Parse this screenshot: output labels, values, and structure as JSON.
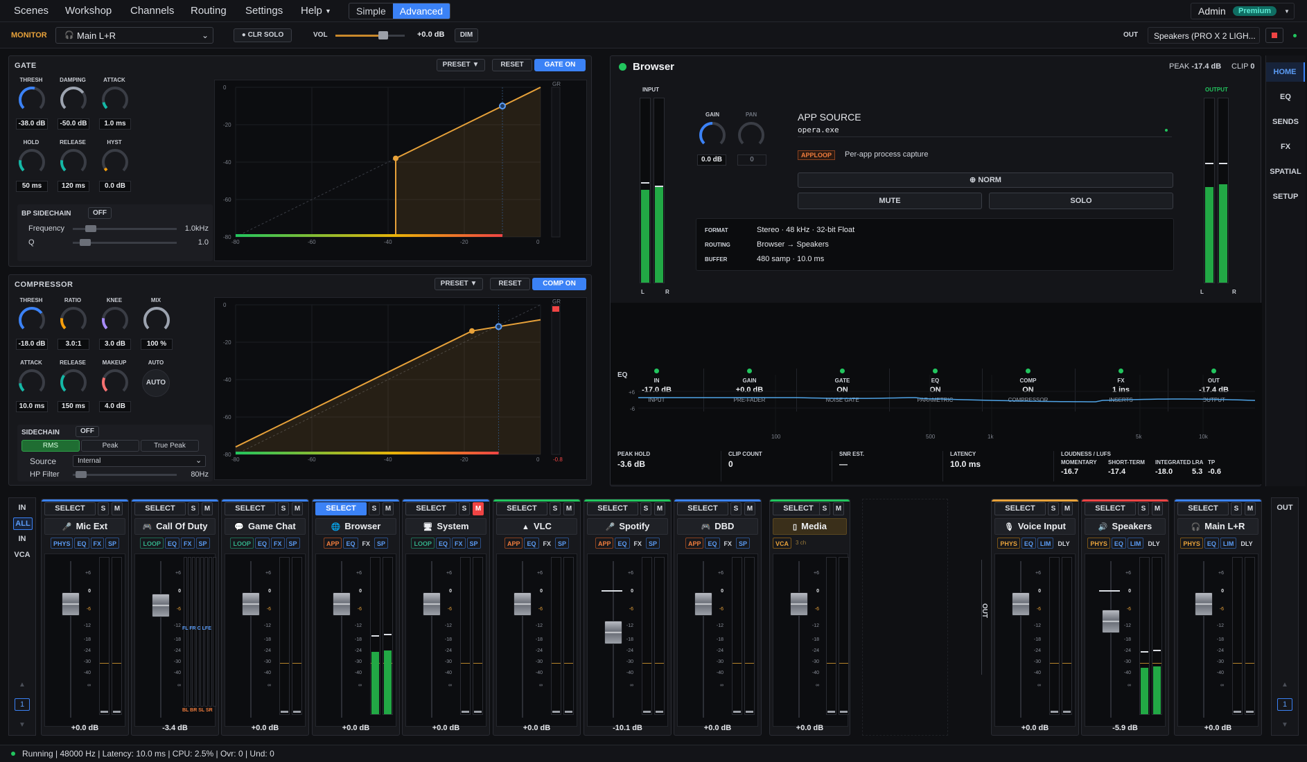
{
  "menu": {
    "items": [
      "Scenes",
      "Workshop",
      "Channels",
      "Routing",
      "Settings",
      "Help"
    ],
    "mode_simple": "Simple",
    "mode_advanced": "Advanced",
    "user": "Admin",
    "badge": "Premium"
  },
  "monitor": {
    "label": "MONITOR",
    "device": "Main L+R",
    "clr_solo": "● CLR SOLO",
    "vol_label": "VOL",
    "vol_value": "+0.0 dB",
    "dim": "DIM",
    "out_label": "OUT",
    "out_device": "Speakers (PRO X 2 LIGH..."
  },
  "gate": {
    "title": "GATE",
    "preset": "PRESET ▼",
    "reset": "RESET",
    "toggle": "GATE ON",
    "knobs": [
      {
        "label": "THRESH",
        "value": "-38.0 dB"
      },
      {
        "label": "DAMPING",
        "value": "-50.0 dB"
      },
      {
        "label": "ATTACK",
        "value": "1.0 ms"
      },
      {
        "label": "HOLD",
        "value": "50 ms"
      },
      {
        "label": "RELEASE",
        "value": "120 ms"
      },
      {
        "label": "HYST",
        "value": "0.0 dB"
      }
    ],
    "sidechain_label": "BP SIDECHAIN",
    "sidechain_state": "OFF",
    "freq_label": "Frequency",
    "freq_value": "1.0kHz",
    "q_label": "Q",
    "q_value": "1.0",
    "y_ticks": [
      "0",
      "-20",
      "-40",
      "-60",
      "-80"
    ],
    "x_ticks": [
      "-80",
      "-60",
      "-40",
      "-20",
      "0"
    ],
    "gr": "GR"
  },
  "comp": {
    "title": "COMPRESSOR",
    "preset": "PRESET ▼",
    "reset": "RESET",
    "toggle": "COMP ON",
    "knobs": [
      {
        "label": "THRESH",
        "value": "-18.0 dB"
      },
      {
        "label": "RATIO",
        "value": "3.0:1"
      },
      {
        "label": "KNEE",
        "value": "3.0 dB"
      },
      {
        "label": "MIX",
        "value": "100 %"
      },
      {
        "label": "ATTACK",
        "value": "10.0 ms"
      },
      {
        "label": "RELEASE",
        "value": "150 ms"
      },
      {
        "label": "MAKEUP",
        "value": "4.0 dB"
      },
      {
        "label": "AUTO",
        "value": "AUTO"
      }
    ],
    "sidechain_label": "SIDECHAIN",
    "sidechain_state": "OFF",
    "modes": [
      "RMS",
      "Peak",
      "True Peak"
    ],
    "source_label": "Source",
    "source_value": "Internal",
    "hp_label": "HP Filter",
    "hp_value": "80Hz",
    "y_ticks": [
      "0",
      "-20",
      "-40",
      "-60",
      "-80"
    ],
    "x_ticks": [
      "-80",
      "-60",
      "-40",
      "-20",
      "0"
    ],
    "gr": "GR",
    "gr_value": "-0.8"
  },
  "channel": {
    "name": "Browser",
    "peak_label": "PEAK",
    "peak_value": "-17.4 dB",
    "clip_label": "CLIP",
    "clip_value": "0",
    "input_label": "INPUT",
    "output_label": "OUTPUT",
    "l": "L",
    "r": "R",
    "gain_label": "GAIN",
    "gain_value": "0.0 dB",
    "pan_label": "PAN",
    "pan_value": "0",
    "source_title": "APP SOURCE",
    "process": "opera.exe",
    "apploop": "APPLOOP",
    "apploop_desc": "Per-app process capture",
    "norm": "⊕ NORM",
    "mute": "MUTE",
    "solo": "SOLO",
    "info": [
      {
        "k": "FORMAT",
        "v": "Stereo · 48 kHz · 32-bit Float"
      },
      {
        "k": "ROUTING",
        "v": "Browser → Speakers"
      },
      {
        "k": "BUFFER",
        "v": "480 samp · 10.0 ms"
      }
    ],
    "stages": [
      {
        "t": "IN",
        "v": "-17.0 dB",
        "s": "INPUT"
      },
      {
        "t": "GAIN",
        "v": "+0.0 dB",
        "s": "PRE-FADER"
      },
      {
        "t": "GATE",
        "v": "ON",
        "s": "NOISE GATE"
      },
      {
        "t": "EQ",
        "v": "ON",
        "s": "PARAMETRIC"
      },
      {
        "t": "COMP",
        "v": "ON",
        "s": "COMPRESSOR"
      },
      {
        "t": "FX",
        "v": "1 ins",
        "s": "INSERTS"
      },
      {
        "t": "OUT",
        "v": "-17.4 dB",
        "s": "OUTPUT"
      }
    ],
    "eq_label": "EQ",
    "eq_y": [
      "+6",
      "-6"
    ],
    "eq_x": [
      "100",
      "500",
      "1k",
      "5k",
      "10k"
    ],
    "stats": [
      {
        "k": "PEAK HOLD",
        "v": "-3.6 dB"
      },
      {
        "k": "CLIP COUNT",
        "v": "0"
      },
      {
        "k": "SNR EST.",
        "v": "—"
      },
      {
        "k": "LATENCY",
        "v": "10.0 ms"
      }
    ],
    "loud_label": "LOUDNESS / LUFS",
    "loud": [
      {
        "k": "MOMENTARY",
        "v": "-16.7"
      },
      {
        "k": "SHORT-TERM",
        "v": "-17.4"
      },
      {
        "k": "INTEGRATED",
        "v": "-18.0"
      },
      {
        "k": "LRA",
        "v": "5.3"
      },
      {
        "k": "TP",
        "v": "-0.6"
      }
    ]
  },
  "sidenav": [
    "HOME",
    "EQ",
    "SENDS",
    "FX",
    "SPATIAL",
    "SETUP"
  ],
  "mixer": {
    "left": [
      "IN",
      "ALL",
      "IN",
      "VCA"
    ],
    "page": "1",
    "out_label": "OUT",
    "out_vertical": "OUT",
    "scale": [
      "+6",
      "0",
      "-6",
      "-12",
      "-18",
      "-24",
      "-30",
      "-40",
      "∞"
    ],
    "select": "SELECT",
    "s": "S",
    "m": "M",
    "strips": [
      {
        "name": "Mic Ext",
        "icon": "mic-icon",
        "glyph": "🎤",
        "tags": [
          "PHYS",
          "EQ",
          "FX",
          "SP"
        ],
        "value": "+0.0 dB",
        "color": "#3b82f6"
      },
      {
        "name": "Call Of Duty",
        "icon": "gamepad-icon",
        "glyph": "🎮",
        "tags": [
          "LOOP",
          "EQ",
          "FX",
          "SP"
        ],
        "value": "-3.4 dB",
        "color": "#3b82f6",
        "surround_top": "FL FR C LFE",
        "surround_bot": "BL BR SL SR"
      },
      {
        "name": "Game Chat",
        "icon": "chat-icon",
        "glyph": "💬",
        "tags": [
          "LOOP",
          "EQ",
          "FX",
          "SP"
        ],
        "value": "+0.0 dB",
        "color": "#3b82f6"
      },
      {
        "name": "Browser",
        "icon": "globe-icon",
        "glyph": "🌐",
        "tags": [
          "APP",
          "EQ",
          "FX",
          "SP"
        ],
        "value": "+0.0 dB",
        "color": "#3b82f6"
      },
      {
        "name": "System",
        "icon": "monitor-icon",
        "glyph": "🖥",
        "tags": [
          "LOOP",
          "EQ",
          "FX",
          "SP"
        ],
        "value": "+0.0 dB",
        "color": "#3b82f6"
      },
      {
        "name": "VLC",
        "icon": "cone-icon",
        "glyph": "▲",
        "tags": [
          "APP",
          "EQ",
          "FX",
          "SP"
        ],
        "value": "+0.0 dB",
        "color": "#22c55e"
      },
      {
        "name": "Spotify",
        "icon": "mic-icon",
        "glyph": "🎤",
        "tags": [
          "APP",
          "EQ",
          "FX",
          "SP"
        ],
        "value": "-10.1 dB",
        "color": "#22c55e"
      },
      {
        "name": "DBD",
        "icon": "gamepad-icon",
        "glyph": "🎮",
        "tags": [
          "APP",
          "EQ",
          "FX",
          "SP"
        ],
        "value": "+0.0 dB",
        "color": "#3b82f6"
      },
      {
        "name": "Media",
        "icon": "file-icon",
        "glyph": "▯",
        "tags": [
          "VCA"
        ],
        "vca_note": "3 ch",
        "value": "+0.0 dB",
        "color": "#22c55e"
      },
      {
        "name": "Voice Input",
        "icon": "mic-icon",
        "glyph": "🎙",
        "tags": [
          "PHYS",
          "EQ",
          "LIM",
          "DLY"
        ],
        "value": "+0.0 dB",
        "color": "#e8a23a"
      },
      {
        "name": "Speakers",
        "icon": "speaker-icon",
        "glyph": "🔊",
        "tags": [
          "PHYS",
          "EQ",
          "LIM",
          "DLY"
        ],
        "value": "-5.9 dB",
        "color": "#ef4444"
      },
      {
        "name": "Main L+R",
        "icon": "headphones-icon",
        "glyph": "🎧",
        "tags": [
          "PHYS",
          "EQ",
          "LIM",
          "DLY"
        ],
        "value": "+0.0 dB",
        "color": "#3b82f6"
      }
    ]
  },
  "status": {
    "text": "Running | 48000 Hz | Latency: 10.0 ms | CPU: 2.5% | Ovr: 0 | Und: 0"
  }
}
